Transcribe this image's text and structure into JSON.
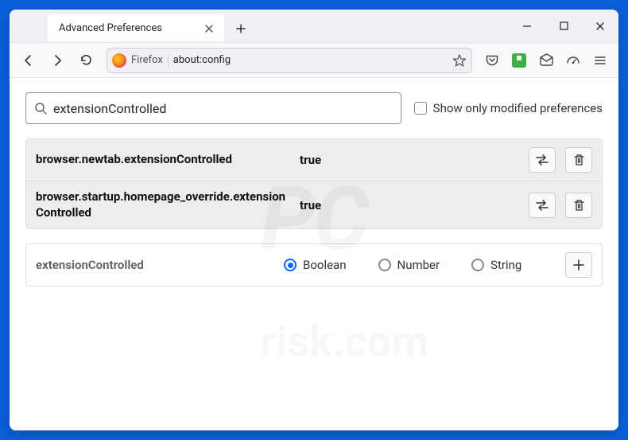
{
  "tab": {
    "title": "Advanced Preferences"
  },
  "urlbar": {
    "identity": "Firefox",
    "url": "about:config"
  },
  "search": {
    "value": "extensionControlled",
    "modified_label": "Show only modified preferences"
  },
  "prefs": [
    {
      "name": "browser.newtab.extensionControlled",
      "value": "true"
    },
    {
      "name": "browser.startup.homepage_override.extensionControlled",
      "value": "true"
    }
  ],
  "new_pref": {
    "name": "extensionControlled",
    "types": [
      "Boolean",
      "Number",
      "String"
    ],
    "selected": "Boolean"
  }
}
